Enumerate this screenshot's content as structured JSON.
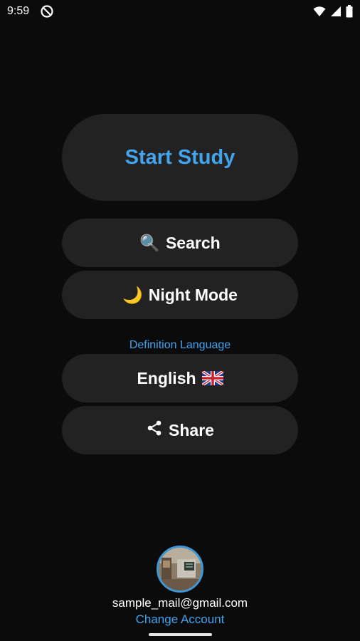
{
  "status_bar": {
    "time": "9:59",
    "icons": [
      "do-not-disturb-icon",
      "wifi-icon",
      "signal-icon",
      "battery-icon"
    ]
  },
  "menu": {
    "start_study": "Start Study",
    "search": {
      "icon": "🔍",
      "label": "Search"
    },
    "night_mode": {
      "icon": "🌙",
      "label": "Night Mode"
    },
    "definition_language_label": "Definition Language",
    "language": {
      "label": "English",
      "flag": "🇬🇧"
    },
    "share": {
      "label": "Share",
      "icon": "share-icon"
    }
  },
  "account": {
    "email": "sample_mail@gmail.com",
    "change_account": "Change Account"
  },
  "colors": {
    "background": "#0b0b0b",
    "button": "#222222",
    "accent": "#43a4ee"
  }
}
